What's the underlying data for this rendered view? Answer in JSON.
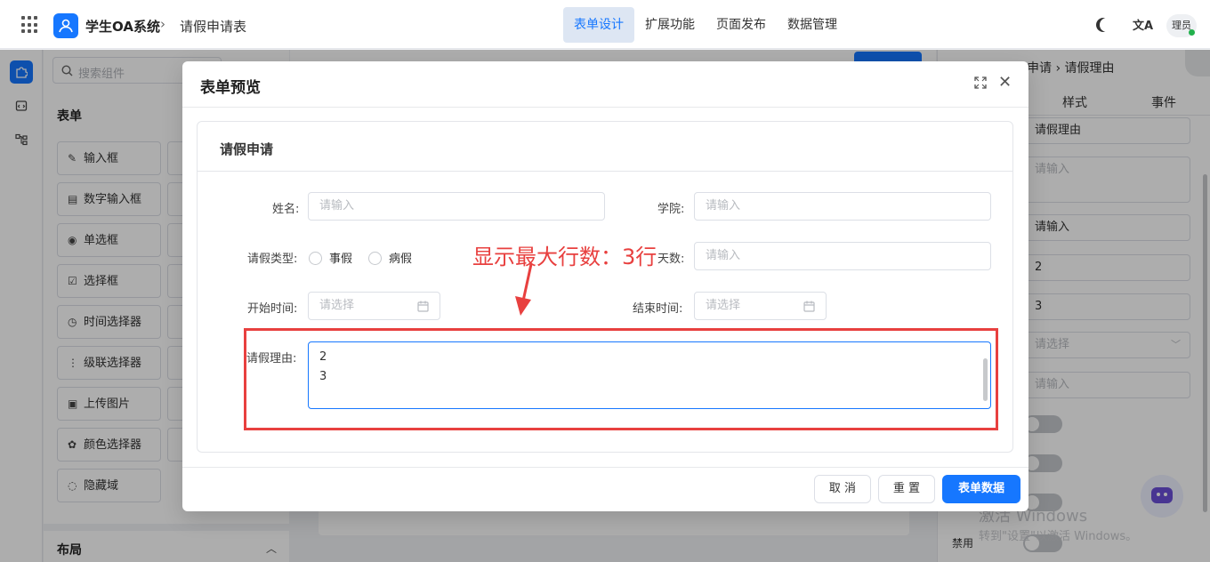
{
  "header": {
    "app_name": "学生OA系统",
    "breadcrumb_sep": "›",
    "page_name": "请假申请表",
    "nav": [
      {
        "label": "表单设计",
        "active": true
      },
      {
        "label": "扩展功能",
        "active": false
      },
      {
        "label": "页面发布",
        "active": false
      },
      {
        "label": "数据管理",
        "active": false
      }
    ],
    "lang_icon_text": "文A",
    "user_label": "理员"
  },
  "components": {
    "search_placeholder": "搜索组件",
    "section_form": "表单",
    "items": [
      {
        "icon": "✎",
        "label": "输入框"
      },
      {
        "icon": "▤",
        "label": "数字输入框"
      },
      {
        "icon": "◉",
        "label": "单选框"
      },
      {
        "icon": "☑",
        "label": "选择框"
      },
      {
        "icon": "◷",
        "label": "时间选择器"
      },
      {
        "icon": "⋮",
        "label": "级联选择器"
      },
      {
        "icon": "▣",
        "label": "上传图片"
      },
      {
        "icon": "✿",
        "label": "颜色选择器"
      },
      {
        "icon": "◌",
        "label": "隐藏域"
      }
    ],
    "section_layout": "布局",
    "layout_chevron": "︿"
  },
  "props": {
    "breadcrumb": "申请 › 请假理由",
    "tabs": [
      "样式",
      "事件"
    ],
    "fields": [
      {
        "value": "请假理由",
        "placeholder": false
      },
      {
        "value": "请输入",
        "placeholder": true
      },
      {
        "value": "请输入",
        "placeholder": false
      },
      {
        "value": "2",
        "placeholder": false
      },
      {
        "value": "3",
        "placeholder": false
      },
      {
        "value": "请选择",
        "placeholder": true
      },
      {
        "value": "请输入",
        "placeholder": true
      }
    ],
    "disabled_label": "禁用"
  },
  "watermark": {
    "line1": "激活 Windows",
    "line2": "转到\"设置\"以激活 Windows。"
  },
  "modal": {
    "title": "表单预览",
    "close_icon": "✕",
    "card_title": "请假申请",
    "fields": {
      "name_label": "姓名:",
      "name_placeholder": "请输入",
      "college_label": "学院:",
      "college_placeholder": "请输入",
      "leave_type_label": "请假类型:",
      "leave_type_options": [
        "事假",
        "病假"
      ],
      "days_label": "天数:",
      "days_placeholder": "请输入",
      "start_label": "开始时间:",
      "start_placeholder": "请选择",
      "end_label": "结束时间:",
      "end_placeholder": "请选择",
      "reason_label": "请假理由:",
      "reason_lines": [
        "2",
        "3"
      ]
    },
    "annotation": "显示最大行数：3行",
    "buttons": {
      "cancel": "取 消",
      "reset": "重 置",
      "submit": "表单数据"
    }
  },
  "colors": {
    "primary": "#1677ff",
    "annotation_red": "#e8403f"
  }
}
